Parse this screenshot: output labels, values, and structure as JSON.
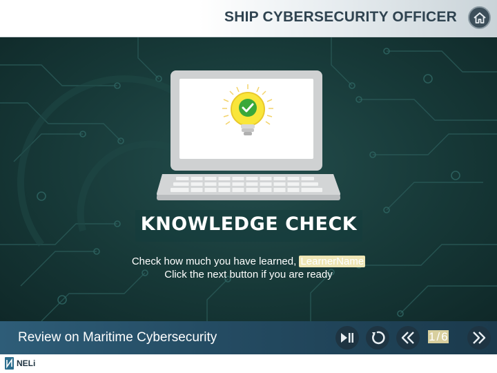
{
  "header": {
    "title": "SHIP CYBERSECURITY OFFICER",
    "home_icon": "home-icon"
  },
  "main": {
    "title": "KNOWLEDGE CHECK",
    "message_prefix": "Check how much you have learned, ",
    "learner_name": "LearnerName",
    "message_line2": "Click the next button if you are ready",
    "illustration": "laptop-lightbulb-checkmark"
  },
  "footer": {
    "course_title": "Review on Maritime Cybersecurity",
    "controls": [
      "play-pause-icon",
      "replay-icon",
      "previous-icon",
      "next-icon"
    ],
    "page_current": "1",
    "page_separator": "/",
    "page_total": "6"
  },
  "brand": {
    "logo_text": "NELi"
  },
  "colors": {
    "header_text": "#2f4350",
    "background_dark": "#173938",
    "footer_bar": "#244b62",
    "highlight": "#efe6b6",
    "bulb_yellow": "#f7e21c",
    "check_green": "#3aa83a"
  }
}
